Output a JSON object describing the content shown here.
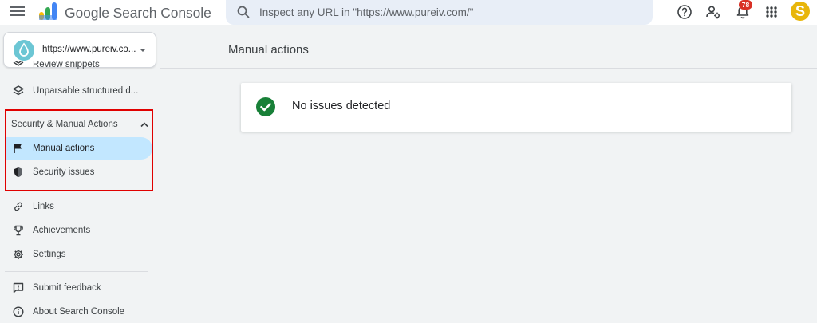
{
  "app": {
    "brand": "Google Search Console",
    "search_placeholder": "Inspect any URL in \"https://www.pureiv.com/\"",
    "notification_count": "78",
    "avatar_letter": "S"
  },
  "property": {
    "label": "https://www.pureiv.co..."
  },
  "sidebar": {
    "clipped_item": "Review snippets",
    "items_top": [
      {
        "label": "Unparsable structured d...",
        "icon": "layers-icon"
      }
    ],
    "section": {
      "label": "Security & Manual Actions",
      "expanded": true,
      "items": [
        {
          "label": "Manual actions",
          "icon": "flag-icon",
          "active": true
        },
        {
          "label": "Security issues",
          "icon": "shield-icon",
          "active": false
        }
      ]
    },
    "items_bottom": [
      {
        "label": "Links",
        "icon": "link-icon"
      },
      {
        "label": "Achievements",
        "icon": "trophy-icon"
      },
      {
        "label": "Settings",
        "icon": "gear-icon"
      }
    ],
    "footer_items": [
      {
        "label": "Submit feedback",
        "icon": "feedback-icon"
      },
      {
        "label": "About Search Console",
        "icon": "info-icon"
      }
    ]
  },
  "main": {
    "title": "Manual actions",
    "status_text": "No issues detected"
  },
  "colors": {
    "accent_active": "#c2e7ff",
    "success": "#188038",
    "highlight_border": "#e00000",
    "badge": "#d93025"
  }
}
